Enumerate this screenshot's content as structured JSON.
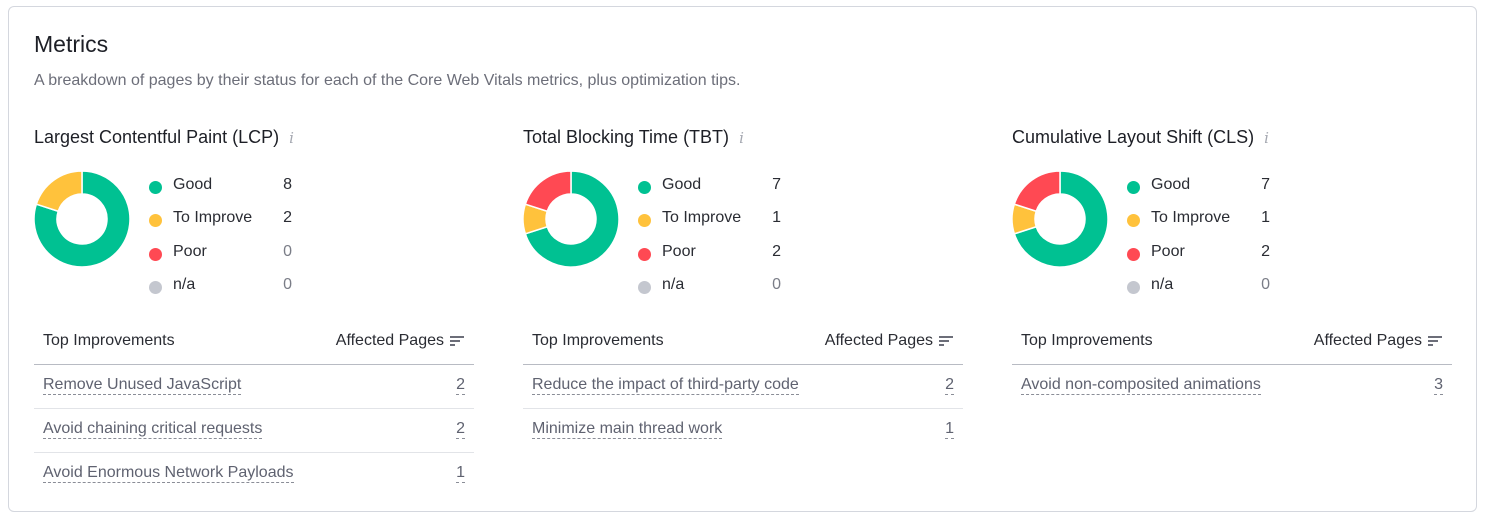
{
  "header": {
    "title": "Metrics",
    "subtitle": "A breakdown of pages by their status for each of the Core Web Vitals metrics, plus optimization tips."
  },
  "colors": {
    "good": "#00c192",
    "improve": "#ffc23c",
    "poor": "#ff4953",
    "na": "#c4c7cf"
  },
  "legend_labels": {
    "good": "Good",
    "improve": "To Improve",
    "poor": "Poor",
    "na": "n/a"
  },
  "table_headers": {
    "improvements": "Top Improvements",
    "affected": "Affected Pages"
  },
  "metrics": [
    {
      "title": "Largest Contentful Paint (LCP)",
      "counts": {
        "good": 8,
        "improve": 2,
        "poor": 0,
        "na": 0
      },
      "improvements": [
        {
          "name": "Remove Unused JavaScript",
          "pages": "2"
        },
        {
          "name": "Avoid chaining critical requests",
          "pages": "2"
        },
        {
          "name": "Avoid Enormous Network Payloads",
          "pages": "1"
        }
      ]
    },
    {
      "title": "Total Blocking Time (TBT)",
      "counts": {
        "good": 7,
        "improve": 1,
        "poor": 2,
        "na": 0
      },
      "improvements": [
        {
          "name": "Reduce the impact of third-party code",
          "pages": "2"
        },
        {
          "name": "Minimize main thread work",
          "pages": "1"
        }
      ]
    },
    {
      "title": "Cumulative Layout Shift (CLS)",
      "counts": {
        "good": 7,
        "improve": 1,
        "poor": 2,
        "na": 0
      },
      "improvements": [
        {
          "name": "Avoid non-composited animations",
          "pages": "3"
        }
      ]
    }
  ]
}
